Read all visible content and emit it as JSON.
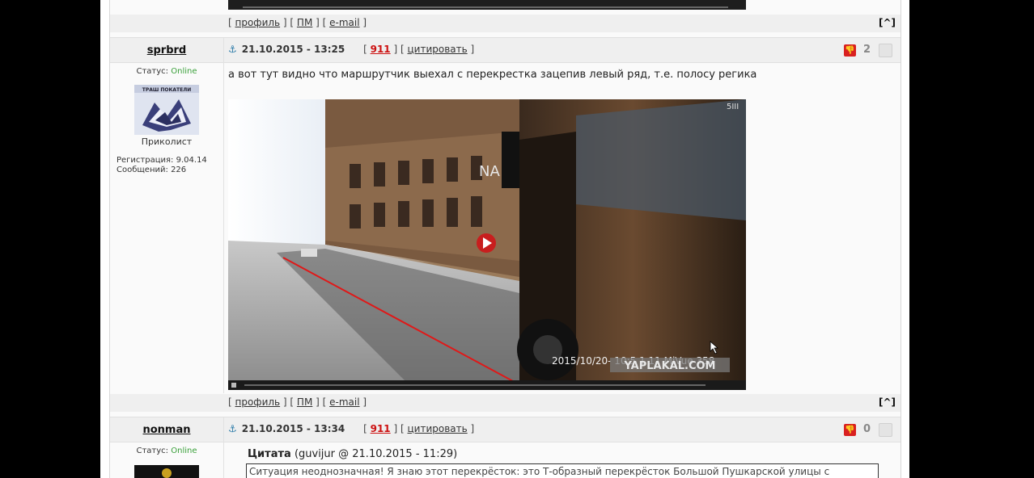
{
  "footer_links": {
    "profile": "профиль",
    "pm": "ПМ",
    "email": "e-mail",
    "to_top": "[^]"
  },
  "posts": [
    {
      "author": "sprbrd",
      "date": "21.10.2015 - 13:25",
      "report": "911",
      "quote_label": "цитировать",
      "votes": "2",
      "status_label": "Статус:",
      "status": "Online",
      "rank": "Приколист",
      "reg_label": "Регистрация:",
      "reg_date": "9.04.14",
      "msgs_label": "Сообщений:",
      "msgs": "226",
      "avatar_caption": "ТРАШ ПОКАТЕЛИ",
      "text": "а вот тут видно что маршрутчик выехал с перекрестка зацепив левый ряд, т.е. полосу регика",
      "video": {
        "timestamp": "2015/10/20- 10:5 1 11 MiVue 358",
        "watermark": "YAPLAKAL.COM",
        "brand": "NA",
        "corner": "5III"
      }
    },
    {
      "author": "nonman",
      "date": "21.10.2015 - 13:34",
      "report": "911",
      "quote_label": "цитировать",
      "votes": "0",
      "status_label": "Статус:",
      "status": "Online",
      "quote_title": "Цитата",
      "quote_meta": "(guvijur @ 21.10.2015 - 11:29)",
      "quote_text": "Ситуация неоднозначная! Я знаю этот перекрёсток: это Т-образный перекрёсток Большой Пушкарской улицы с"
    }
  ],
  "colors": {
    "report": "#cc1111",
    "online": "#3aa03a",
    "anchor": "#2a7aa8",
    "vote": "#d92020"
  }
}
